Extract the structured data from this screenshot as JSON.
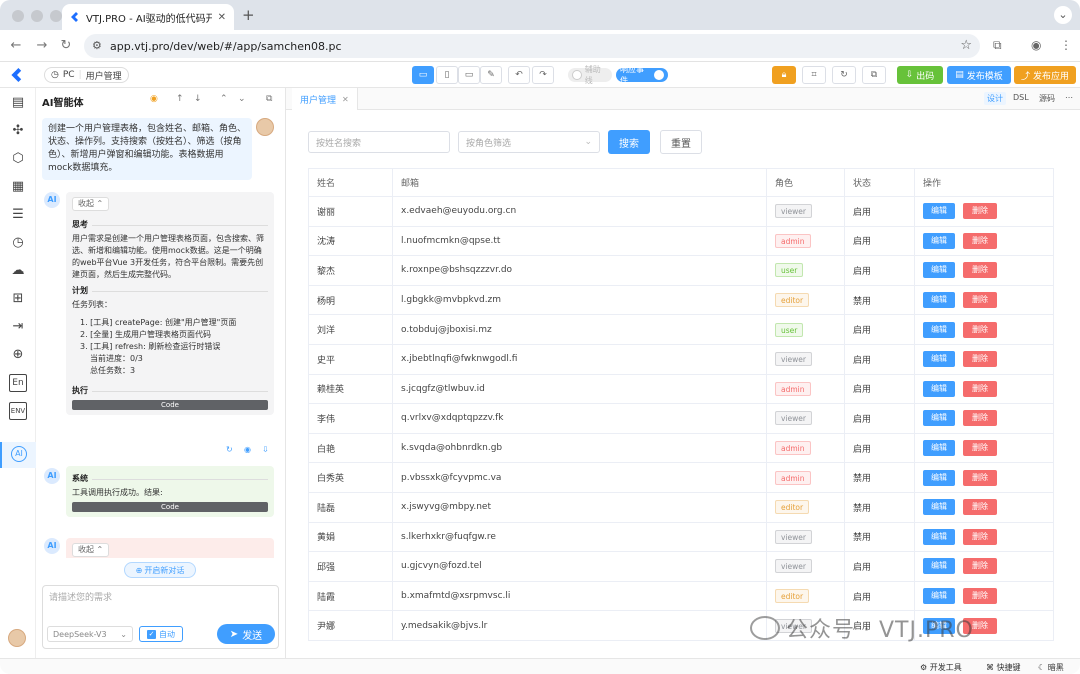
{
  "browser": {
    "tab_title": "VTJ.PRO - AI驱动的低代码开发",
    "url": "app.vtj.pro/dev/web/#/app/samchen08.pc"
  },
  "toolbar": {
    "platform": "PC",
    "page_name": "用户管理",
    "switch_assist": "辅助线",
    "switch_events": "响应事件",
    "btn_publish_out": "出码",
    "btn_publish_template": "发布模板",
    "btn_publish_app": "发布应用"
  },
  "ai": {
    "title": "AI智能体",
    "user_message": "创建一个用户管理表格，包含姓名、邮箱、角色、状态、操作列。支持搜索（按姓名）、筛选（按角色）、新增用户弹窗和编辑功能。表格数据用mock数据填充。",
    "collapse_label": "收起",
    "think_title": "思考",
    "think_text": "用户需求是创建一个用户管理表格页面，包含搜索、筛选、新增和编辑功能。使用mock数据。这是一个明确的web平台Vue 3开发任务，符合平台限制。需要先创建页面，然后生成完整代码。",
    "plan_title": "计划",
    "plan_intro": "任务列表：",
    "plan_items": [
      "1. [工具] createPage: 创建\"用户管理\"页面",
      "2. [全量] 生成用户管理表格页面代码",
      "3. [工具] refresh: 刷新检查运行时错误"
    ],
    "progress": "当前进度：0/3",
    "total": "总任务数：3",
    "exec_title": "执行",
    "code_label": "Code",
    "sys_title": "系统",
    "sys_text": "工具调用执行成功。结果:",
    "new_chat": "开启新对话",
    "input_placeholder": "请描述您的需求",
    "model": "DeepSeek-V3",
    "auto_label": "自动",
    "send_label": "发送"
  },
  "main": {
    "tab_label": "用户管理",
    "mode_design": "设计",
    "mode_dsl": "DSL",
    "mode_source": "源码",
    "search_placeholder": "按姓名搜索",
    "filter_placeholder": "按角色筛选",
    "btn_search": "搜索",
    "btn_reset": "重置",
    "columns": [
      "姓名",
      "邮箱",
      "角色",
      "状态",
      "操作"
    ],
    "edit_label": "编辑",
    "delete_label": "删除",
    "rows": [
      {
        "name": "谢丽",
        "email": "x.edvaeh@euyodu.org.cn",
        "role": "viewer",
        "status": "启用"
      },
      {
        "name": "沈涛",
        "email": "l.nuofmcmkn@qpse.tt",
        "role": "admin",
        "status": "启用"
      },
      {
        "name": "黎杰",
        "email": "k.roxnpe@bshsqzzzvr.do",
        "role": "user",
        "status": "启用"
      },
      {
        "name": "杨明",
        "email": "l.gbgkk@mvbpkvd.zm",
        "role": "editor",
        "status": "禁用"
      },
      {
        "name": "刘洋",
        "email": "o.tobduj@jboxisi.mz",
        "role": "user",
        "status": "启用"
      },
      {
        "name": "史平",
        "email": "x.jbebtlnqfi@fwknwgodl.fi",
        "role": "viewer",
        "status": "启用"
      },
      {
        "name": "赖桂英",
        "email": "s.jcqgfz@tlwbuv.id",
        "role": "admin",
        "status": "启用"
      },
      {
        "name": "李伟",
        "email": "q.vrlxv@xdqptqpzzv.fk",
        "role": "viewer",
        "status": "启用"
      },
      {
        "name": "白艳",
        "email": "k.svqda@ohbnrdkn.gb",
        "role": "admin",
        "status": "启用"
      },
      {
        "name": "白秀英",
        "email": "p.vbssxk@fcyvpmc.va",
        "role": "admin",
        "status": "禁用"
      },
      {
        "name": "陆磊",
        "email": "x.jswyvg@mbpy.net",
        "role": "editor",
        "status": "禁用"
      },
      {
        "name": "黄娟",
        "email": "s.lkerhxkr@fuqfgw.re",
        "role": "viewer",
        "status": "禁用"
      },
      {
        "name": "邱强",
        "email": "u.gjcvyn@fozd.tel",
        "role": "viewer",
        "status": "启用"
      },
      {
        "name": "陆霞",
        "email": "b.xmafmtd@xsrpmvsc.li",
        "role": "editor",
        "status": "启用"
      },
      {
        "name": "尹娜",
        "email": "y.medsakik@bjvs.lr",
        "role": "viewer",
        "status": "启用"
      }
    ]
  },
  "footer": {
    "devtools": "开发工具",
    "shortcuts": "快捷键",
    "dark": "暗黑"
  },
  "watermark": "公众号 · VTJ.PRO",
  "colors": {
    "primary": "#409eff",
    "danger": "#f56c6c",
    "warning": "#f0a020",
    "success": "#67c23a",
    "tag_viewer": "#909399",
    "tag_admin": "#f56c6c",
    "tag_user": "#67c23a",
    "tag_editor": "#e6a23c"
  }
}
